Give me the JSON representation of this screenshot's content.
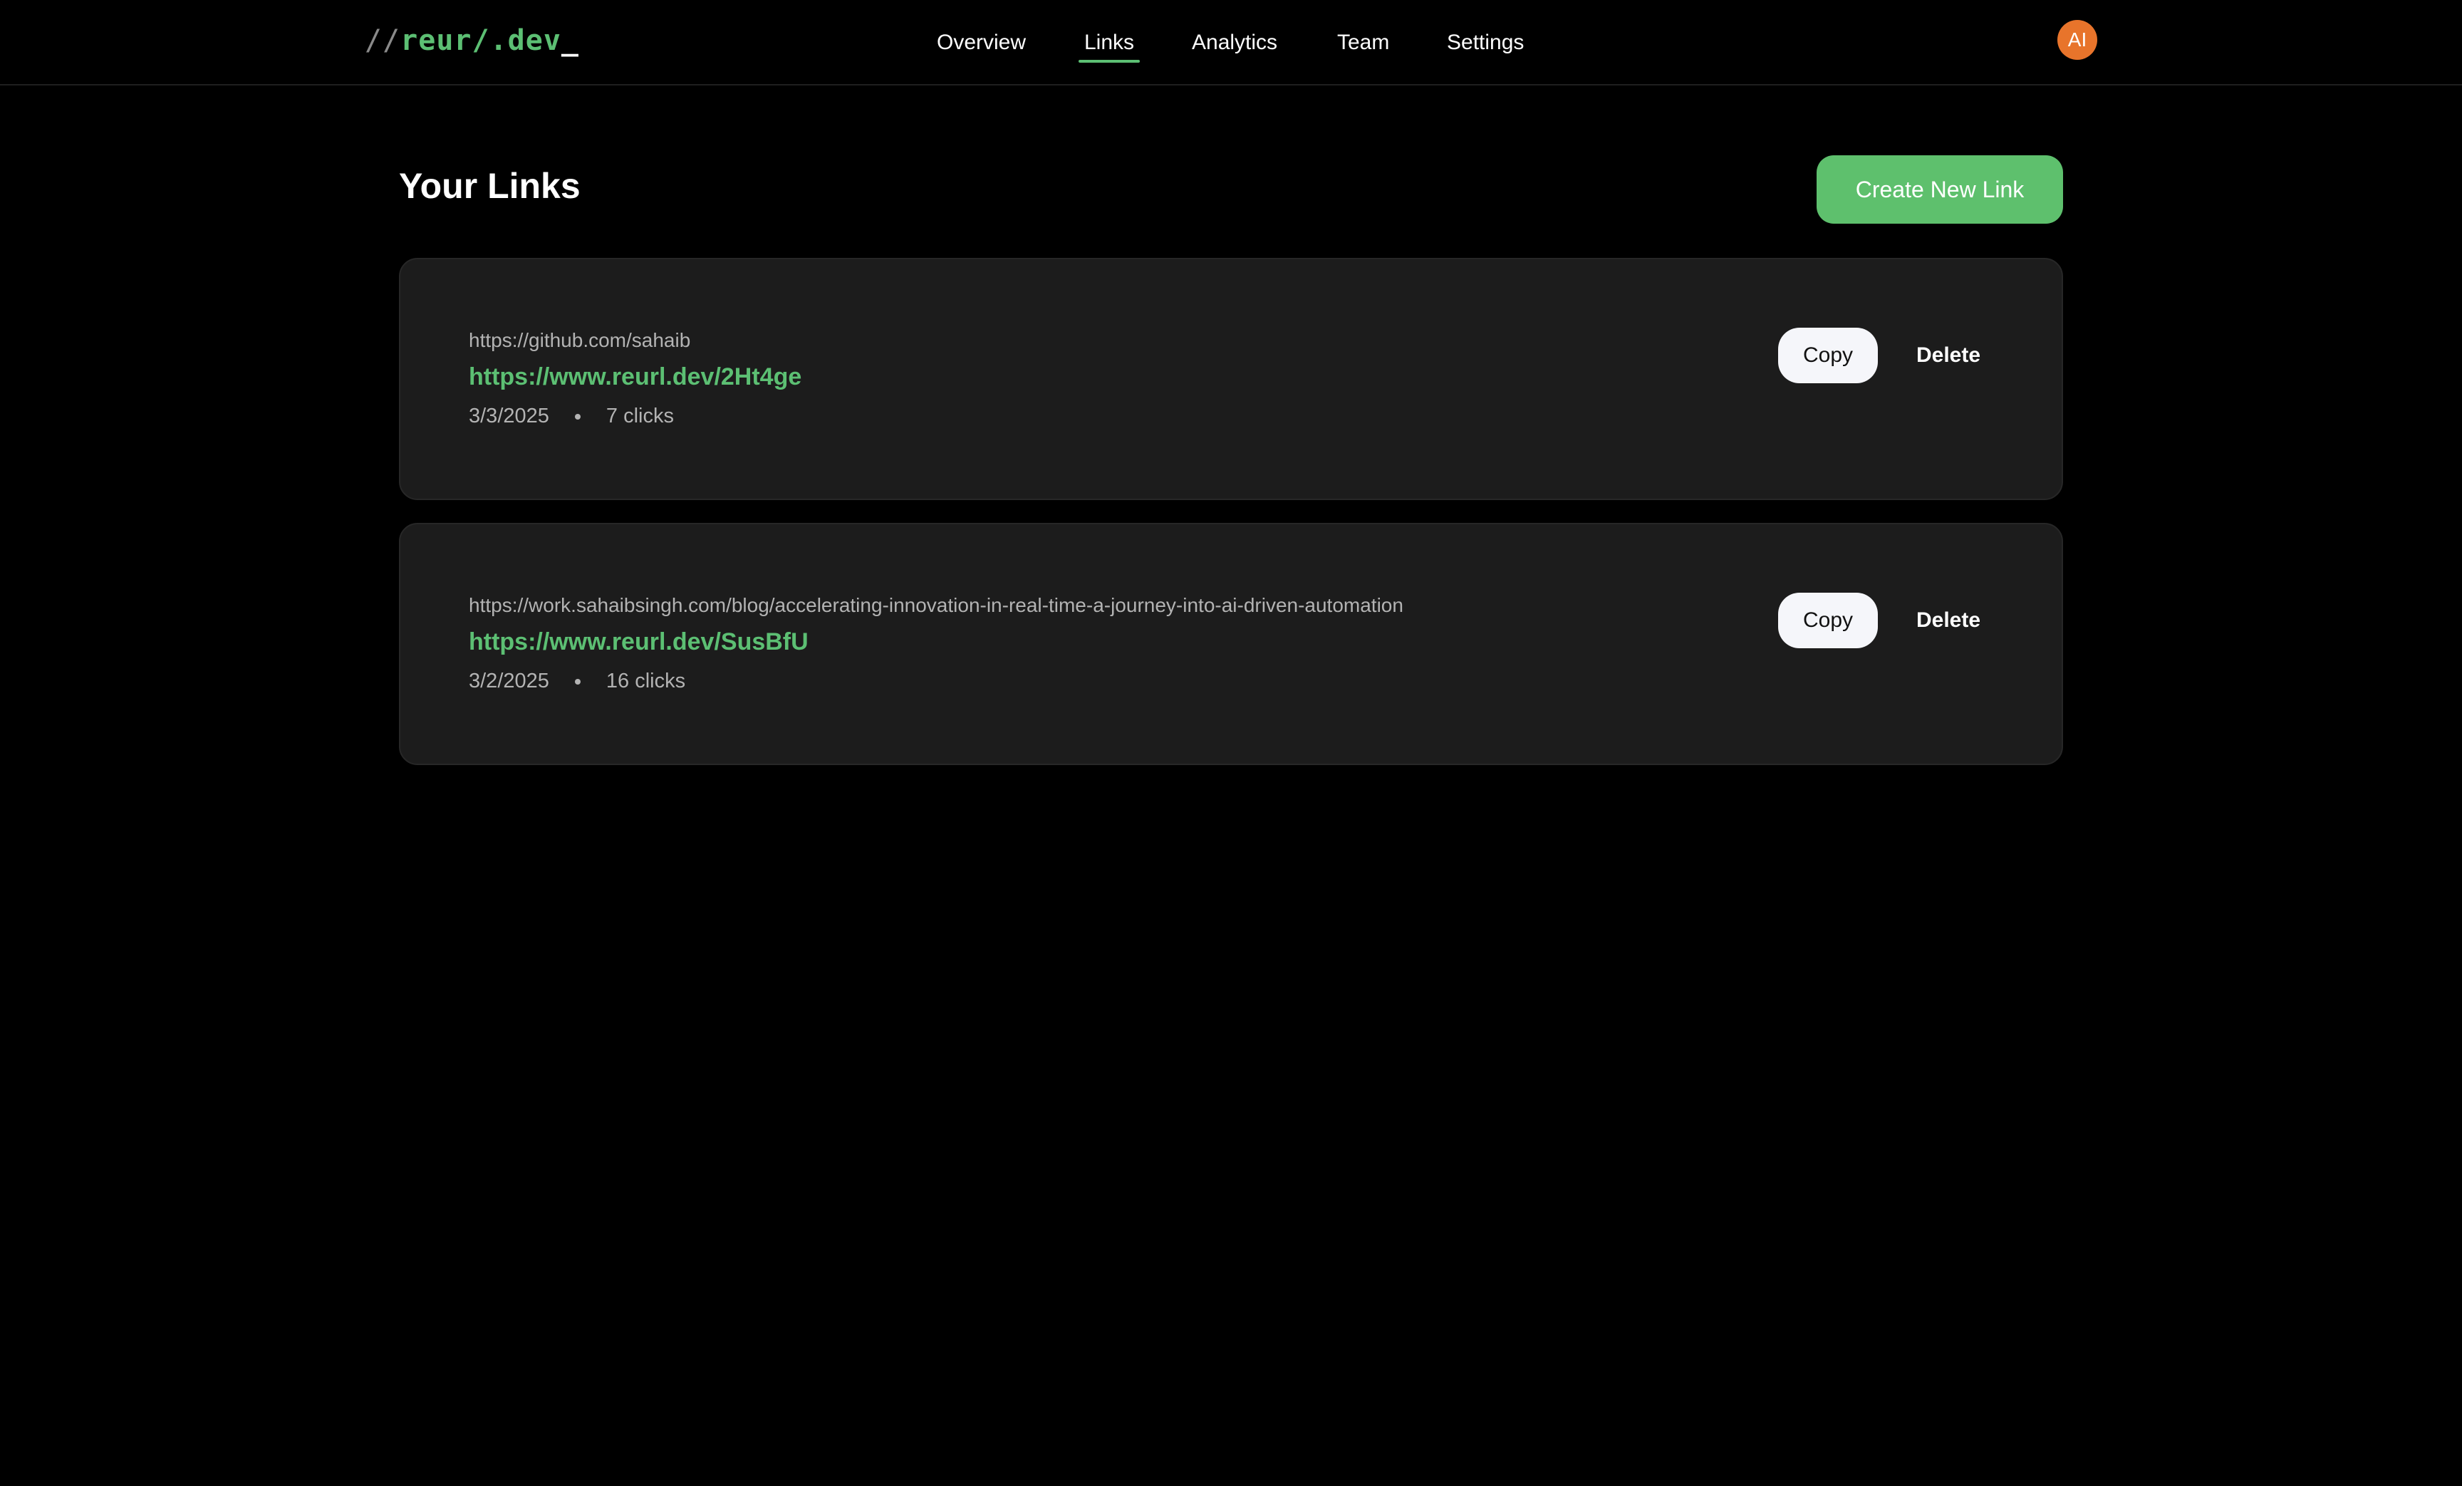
{
  "header": {
    "logo": {
      "slashes": "//",
      "brand": "reur/.dev",
      "cursor": "_"
    },
    "nav": [
      {
        "label": "Overview",
        "active": false
      },
      {
        "label": "Links",
        "active": true
      },
      {
        "label": "Analytics",
        "active": false
      },
      {
        "label": "Team",
        "active": false
      },
      {
        "label": "Settings",
        "active": false
      }
    ],
    "avatar_initials": "AI"
  },
  "main": {
    "title": "Your Links",
    "create_button_label": "Create New Link",
    "links": [
      {
        "original_url": "https://github.com/sahaib",
        "short_url": "https://www.reurl.dev/2Ht4ge",
        "date": "3/3/2025",
        "clicks": "7 clicks",
        "copy_label": "Copy",
        "delete_label": "Delete"
      },
      {
        "original_url": "https://work.sahaibsingh.com/blog/accelerating-innovation-in-real-time-a-journey-into-ai-driven-automation",
        "short_url": "https://www.reurl.dev/SusBfU",
        "date": "3/2/2025",
        "clicks": "16 clicks",
        "copy_label": "Copy",
        "delete_label": "Delete"
      }
    ]
  },
  "colors": {
    "background": "#000000",
    "accent": "#5cbf73",
    "card": "#1c1c1c",
    "avatar": "#e8742b"
  }
}
